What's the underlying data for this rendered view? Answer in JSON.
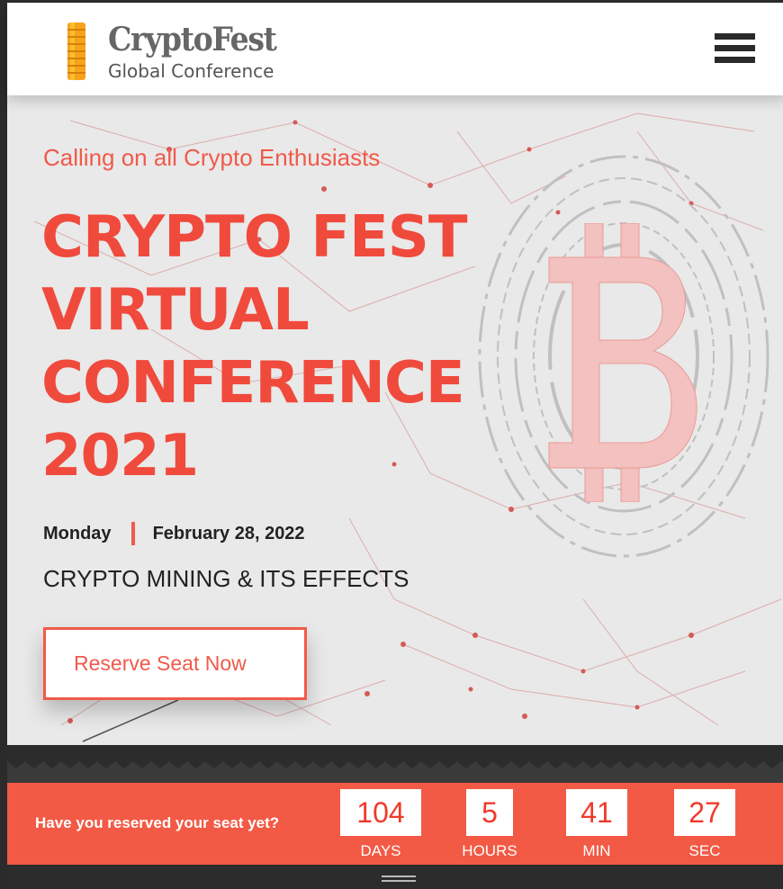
{
  "header": {
    "brand": "CryptoFest",
    "subtitle": "Global Conference",
    "menu_icon": "hamburger-menu-icon",
    "logo_icon": "coin-stack-icon"
  },
  "hero": {
    "tagline": "Calling on all Crypto Enthusiasts",
    "headline": [
      "CRYPTO FEST",
      "VIRTUAL",
      "CONFERENCE",
      "2021"
    ],
    "day": "Monday",
    "date": "February 28, 2022",
    "topic": "CRYPTO MINING & ITS EFFECTS",
    "cta": "Reserve Seat Now",
    "illustration_icon": "bitcoin-icon"
  },
  "countdown": {
    "question": "Have you reserved your seat yet?",
    "units": [
      {
        "value": "104",
        "label": "DAYS"
      },
      {
        "value": "5",
        "label": "HOURS"
      },
      {
        "value": "41",
        "label": "MIN"
      },
      {
        "value": "27",
        "label": "SEC"
      }
    ]
  },
  "colors": {
    "accent": "#f05a4a",
    "countbar": "#f25a45",
    "dark": "#2c2c2c",
    "hero_bg": "#e9e9e9"
  }
}
